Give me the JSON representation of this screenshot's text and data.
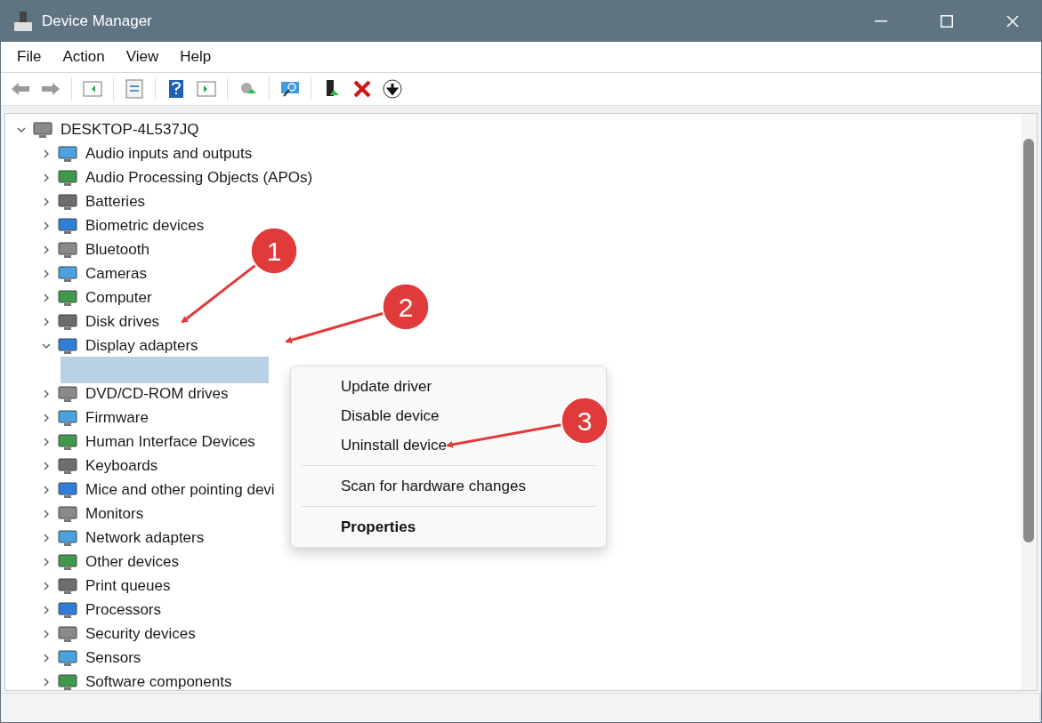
{
  "window": {
    "title": "Device Manager"
  },
  "menu": [
    "File",
    "Action",
    "View",
    "Help"
  ],
  "tree": {
    "label": "DESKTOP-4L537JQ",
    "expanded": true,
    "children": [
      {
        "label": "Audio inputs and outputs",
        "expanded": false
      },
      {
        "label": "Audio Processing Objects (APOs)",
        "expanded": false
      },
      {
        "label": "Batteries",
        "expanded": false
      },
      {
        "label": "Biometric devices",
        "expanded": false
      },
      {
        "label": "Bluetooth",
        "expanded": false
      },
      {
        "label": "Cameras",
        "expanded": false
      },
      {
        "label": "Computer",
        "expanded": false
      },
      {
        "label": "Disk drives",
        "expanded": false
      },
      {
        "label": "Display adapters",
        "expanded": true,
        "children": [
          {
            "selected": true
          }
        ]
      },
      {
        "label": "DVD/CD-ROM drives",
        "expanded": false
      },
      {
        "label": "Firmware",
        "expanded": false
      },
      {
        "label": "Human Interface Devices",
        "expanded": false
      },
      {
        "label": "Keyboards",
        "expanded": false
      },
      {
        "label": "Mice and other pointing devi",
        "expanded": false
      },
      {
        "label": "Monitors",
        "expanded": false
      },
      {
        "label": "Network adapters",
        "expanded": false
      },
      {
        "label": "Other devices",
        "expanded": false
      },
      {
        "label": "Print queues",
        "expanded": false
      },
      {
        "label": "Processors",
        "expanded": false
      },
      {
        "label": "Security devices",
        "expanded": false
      },
      {
        "label": "Sensors",
        "expanded": false
      },
      {
        "label": "Software components",
        "expanded": false
      }
    ]
  },
  "context_menu": [
    {
      "kind": "item",
      "label": "Update driver",
      "default": false
    },
    {
      "kind": "item",
      "label": "Disable device",
      "default": false
    },
    {
      "kind": "item",
      "label": "Uninstall device",
      "default": false
    },
    {
      "kind": "separator"
    },
    {
      "kind": "item",
      "label": "Scan for hardware changes",
      "default": false
    },
    {
      "kind": "separator"
    },
    {
      "kind": "item",
      "label": "Properties",
      "default": true
    }
  ],
  "annotations": [
    {
      "label": "1"
    },
    {
      "label": "2"
    },
    {
      "label": "3"
    }
  ]
}
